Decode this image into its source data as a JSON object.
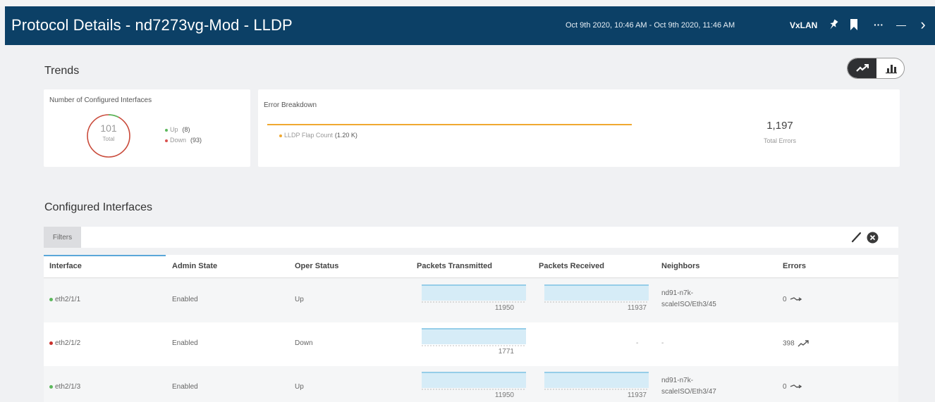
{
  "header": {
    "title": "Protocol Details - nd7273vg-Mod - LLDP",
    "time_range": "Oct 9th 2020, 10:46 AM - Oct 9th 2020, 11:46 AM",
    "fabric": "VxLAN",
    "more": "···",
    "minimize": "—",
    "close": "›"
  },
  "trends": {
    "title": "Trends",
    "view": "line"
  },
  "interfaces_card": {
    "title": "Number of Configured Interfaces",
    "total": "101",
    "total_label": "Total",
    "legend": [
      {
        "label": "Up",
        "count": "(8)",
        "color": "#5cb85c"
      },
      {
        "label": "Down",
        "count": "(93)",
        "color": "#d9534f"
      }
    ]
  },
  "error_card": {
    "title": "Error Breakdown",
    "legend_label": "LLDP Flap Count",
    "legend_value": "(1.20 K)",
    "bar_color": "#f0a830",
    "total": "1,197",
    "total_label": "Total Errors"
  },
  "configured": {
    "title": "Configured Interfaces",
    "filters_label": "Filters",
    "columns": [
      "Interface",
      "Admin State",
      "Oper Status",
      "Packets Transmitted",
      "Packets Received",
      "Neighbors",
      "Errors"
    ],
    "rows": [
      {
        "status_color": "#5cb85c",
        "interface": "eth2/1/1",
        "admin": "Enabled",
        "oper": "Up",
        "tx": "11950",
        "rx": "11937",
        "rx_empty": "",
        "neighbor1": "nd91-n7k-",
        "neighbor2": "scaleISO/Eth3/45",
        "errors": "0",
        "trend": "flat"
      },
      {
        "status_color": "#c9302c",
        "interface": "eth2/1/2",
        "admin": "Enabled",
        "oper": "Down",
        "tx": "1771",
        "rx": "",
        "rx_empty": "-",
        "neighbor1": "-",
        "neighbor2": "",
        "errors": "398",
        "trend": "up"
      },
      {
        "status_color": "#5cb85c",
        "interface": "eth2/1/3",
        "admin": "Enabled",
        "oper": "Up",
        "tx": "11950",
        "rx": "11937",
        "rx_empty": "",
        "neighbor1": "nd91-n7k-",
        "neighbor2": "scaleISO/Eth3/47",
        "errors": "0",
        "trend": "flat"
      }
    ]
  }
}
